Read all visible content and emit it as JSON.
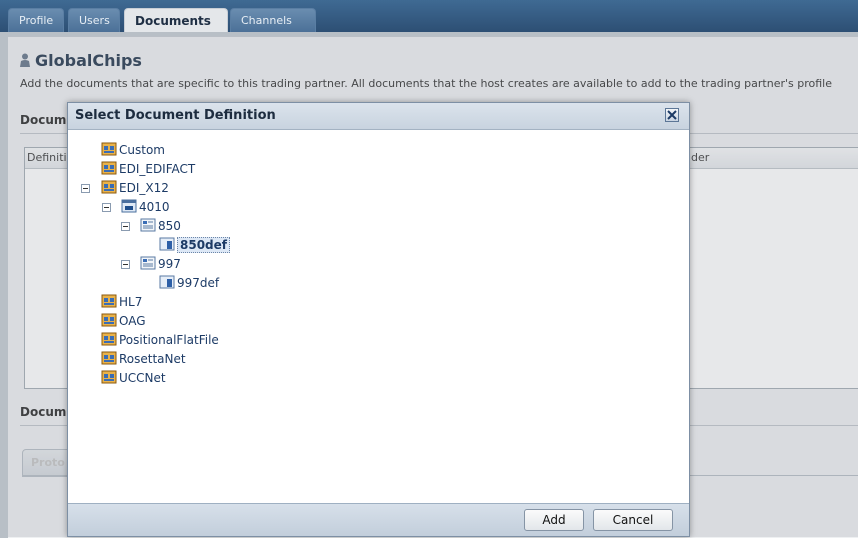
{
  "tabs": [
    {
      "label": "Profile",
      "active": false
    },
    {
      "label": "Users",
      "active": false
    },
    {
      "label": "Documents",
      "active": true
    },
    {
      "label": "Channels",
      "active": false
    }
  ],
  "partner": {
    "name": "GlobalChips",
    "icon": "user-icon"
  },
  "description": "Add the documents that are specific to this trading partner. All documents that the host creates are available to add to the trading partner's profile",
  "sections": {
    "documents_label": "Docum",
    "documents_label_2": "Docum"
  },
  "table": {
    "col1": "Definiti",
    "col2": "der"
  },
  "protocol_tab": "Proto",
  "dialog": {
    "title": "Select Document Definition",
    "close_icon": "close-icon",
    "tree": [
      {
        "label": "Custom",
        "icon": "protocol-icon"
      },
      {
        "label": "EDI_EDIFACT",
        "icon": "protocol-icon"
      },
      {
        "label": "EDI_X12",
        "icon": "protocol-icon",
        "expanded": true
      },
      {
        "label": "4010",
        "icon": "version-icon",
        "expanded": true
      },
      {
        "label": "850",
        "icon": "doctype-icon",
        "expanded": true
      },
      {
        "label": "850def",
        "icon": "definition-icon",
        "selected": true
      },
      {
        "label": "997",
        "icon": "doctype-icon",
        "expanded": true
      },
      {
        "label": "997def",
        "icon": "definition-icon"
      },
      {
        "label": "HL7",
        "icon": "protocol-icon"
      },
      {
        "label": "OAG",
        "icon": "protocol-icon"
      },
      {
        "label": "PositionalFlatFile",
        "icon": "protocol-icon"
      },
      {
        "label": "RosettaNet",
        "icon": "protocol-icon"
      },
      {
        "label": "UCCNet",
        "icon": "protocol-icon"
      }
    ],
    "buttons": {
      "add": "Add",
      "cancel": "Cancel"
    }
  }
}
